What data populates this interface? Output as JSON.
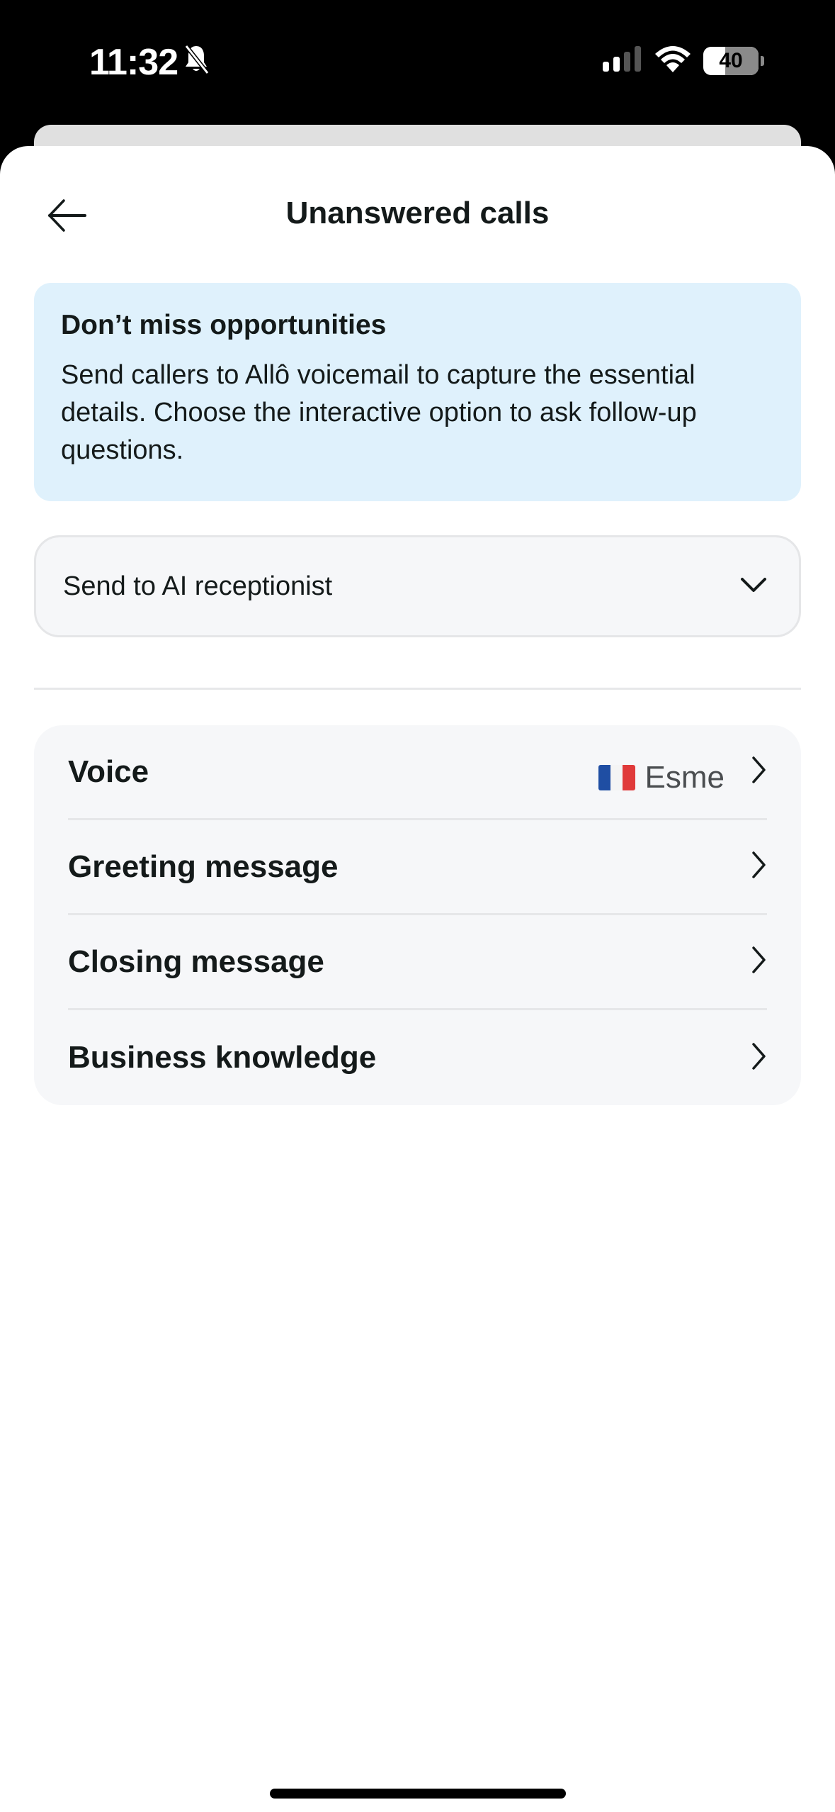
{
  "status_bar": {
    "time": "11:32",
    "silent_mode_icon": "bell-slash-icon",
    "signal_icon": "cellular-signal-icon",
    "wifi_icon": "wifi-icon",
    "battery_level": "40"
  },
  "header": {
    "back_icon": "arrow-left-icon",
    "title": "Unanswered calls"
  },
  "info_card": {
    "title": "Don’t miss opportunities",
    "body": "Send callers to Allô voicemail to capture the essential details. Choose the interactive option to ask follow-up questions.",
    "background_color": "#dff1fc"
  },
  "dropdown": {
    "selected_value": "Send to AI receptionist",
    "icon": "chevron-down-icon"
  },
  "settings": {
    "items": [
      {
        "label": "Voice",
        "value": "Esme",
        "value_icon": "france-flag-icon",
        "icon": "chevron-right-icon"
      },
      {
        "label": "Greeting message",
        "icon": "chevron-right-icon"
      },
      {
        "label": "Closing message",
        "icon": "chevron-right-icon"
      },
      {
        "label": "Business knowledge",
        "icon": "chevron-right-icon"
      }
    ]
  },
  "colors": {
    "text_primary": "#141a1a",
    "card_background": "#f6f7f9",
    "divider": "#e6e7e9"
  }
}
